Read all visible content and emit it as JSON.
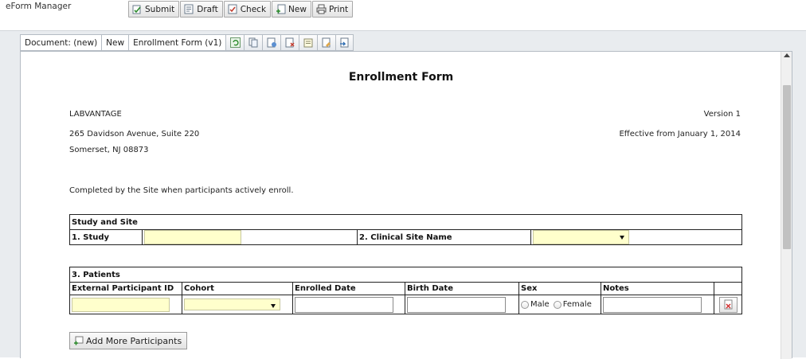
{
  "app": {
    "title": "eForm Manager"
  },
  "toolbar": {
    "buttons": [
      {
        "label": "Submit",
        "icon": "submit-icon"
      },
      {
        "label": "Draft",
        "icon": "draft-icon"
      },
      {
        "label": "Check",
        "icon": "check-icon"
      },
      {
        "label": "New",
        "icon": "new-icon"
      },
      {
        "label": "Print",
        "icon": "print-icon"
      }
    ]
  },
  "tabs": [
    {
      "label": "Document: (new)"
    },
    {
      "label": "New"
    },
    {
      "label": "Enrollment Form (v1)"
    }
  ],
  "tab_icons": [
    "refresh-icon",
    "copy-icon",
    "attach-icon",
    "delete-icon",
    "notes-icon",
    "history-icon",
    "export-icon"
  ],
  "form": {
    "title": "Enrollment Form",
    "company": "LABVANTAGE",
    "address_line1": "265 Davidson Avenue, Suite 220",
    "address_line2": "Somerset, NJ 08873",
    "version": "Version 1",
    "effective": "Effective from January 1, 2014",
    "instructions": "Completed by the Site when participants actively enroll.",
    "study_site": {
      "section_title": "Study and Site",
      "study_label": "1. Study",
      "study_value": "",
      "site_label": "2. Clinical Site Name",
      "site_value": ""
    },
    "patients": {
      "section_title": "3. Patients",
      "columns": [
        "External Participant ID",
        "Cohort",
        "Enrolled Date",
        "Birth Date",
        "Sex",
        "Notes"
      ],
      "row": {
        "participant_id": "",
        "cohort": "",
        "enrolled_date": "",
        "birth_date": "",
        "sex_options": [
          "Male",
          "Female"
        ],
        "notes": ""
      }
    },
    "add_button_label": "Add More Participants"
  },
  "colors": {
    "required_field": "#ffffcc",
    "workspace_bg": "#e9ecef"
  }
}
